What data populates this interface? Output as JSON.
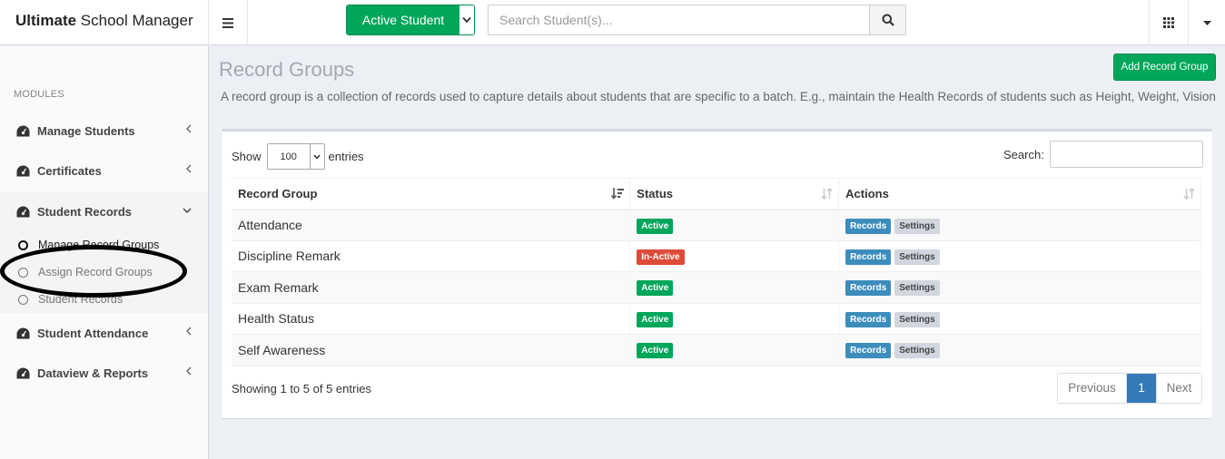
{
  "app": {
    "brand_bold": "Ultimate",
    "brand_rest": " School Manager"
  },
  "header": {
    "mode_label": "Active Student",
    "search_placeholder": "Search Student(s)..."
  },
  "sidebar": {
    "section_label": "MODULES",
    "items": [
      {
        "label": "Manage Students"
      },
      {
        "label": "Certificates"
      },
      {
        "label": "Student Records"
      },
      {
        "label": "Student Attendance"
      },
      {
        "label": "Dataview & Reports"
      }
    ],
    "sub_items": [
      {
        "label": "Manage Record Groups",
        "active": true
      },
      {
        "label": "Assign Record Groups",
        "active": false
      },
      {
        "label": "Student Records",
        "active": false
      }
    ]
  },
  "page": {
    "title": "Record Groups",
    "description": "A record group is a collection of records used to capture details about students that are specific to a batch. E.g., maintain the Health Records of students such as Height, Weight, Vision",
    "add_button": "Add Record Group"
  },
  "table_controls": {
    "show_label": "Show",
    "page_length": "100",
    "entries_label": "entries",
    "search_label": "Search:"
  },
  "table": {
    "columns": [
      "Record Group",
      "Status",
      "Actions"
    ],
    "rows": [
      {
        "name": "Attendance",
        "status": "Active"
      },
      {
        "name": "Discipline Remark",
        "status": "In-Active"
      },
      {
        "name": "Exam Remark",
        "status": "Active"
      },
      {
        "name": "Health Status",
        "status": "Active"
      },
      {
        "name": "Self Awareness",
        "status": "Active"
      }
    ],
    "action_records": "Records",
    "action_settings": "Settings"
  },
  "footer": {
    "info": "Showing 1 to 5 of 5 entries",
    "prev": "Previous",
    "page": "1",
    "next": "Next"
  },
  "colors": {
    "green": "#00a65a",
    "red": "#dd4b39",
    "blue": "#3c8dbc",
    "gray_badge": "#d2d6de"
  }
}
